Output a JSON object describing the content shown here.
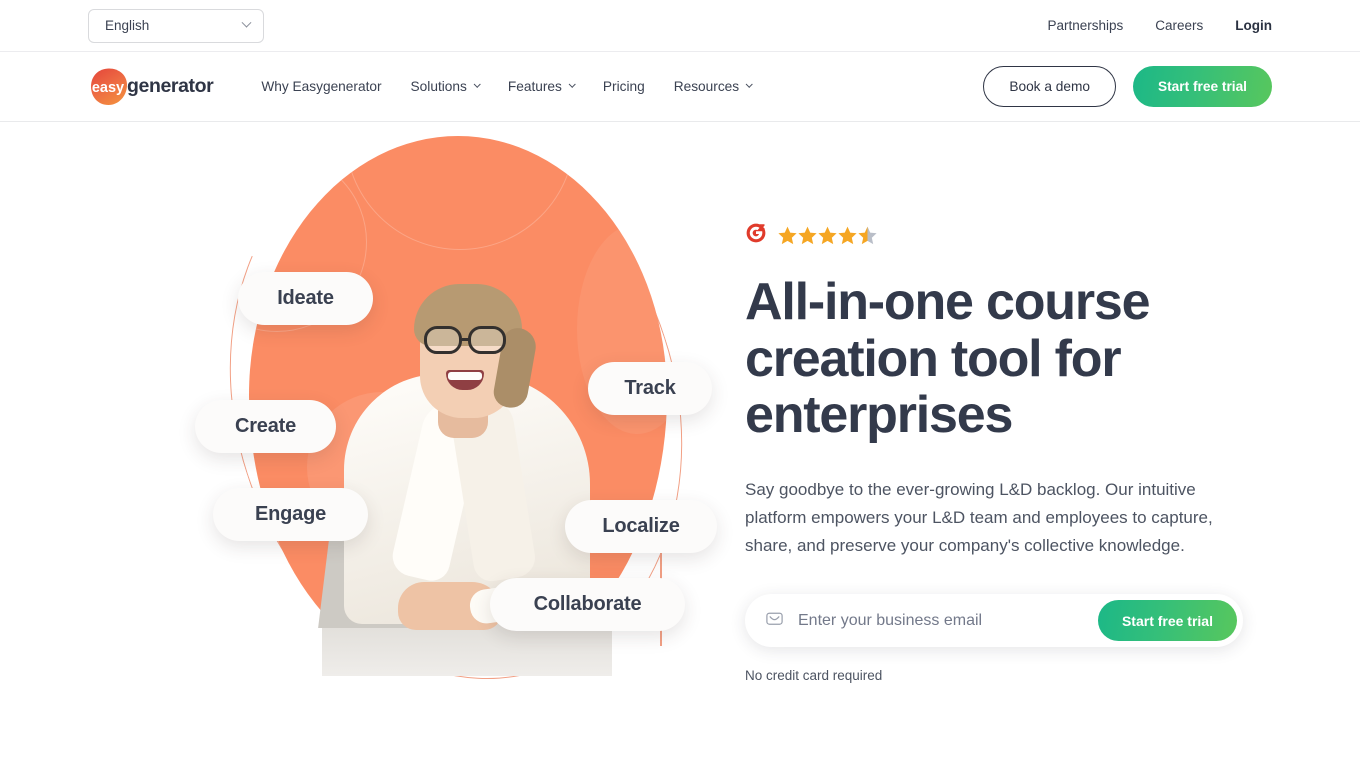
{
  "utility_bar": {
    "language": {
      "value": "English",
      "icon": "chevron-down-icon"
    },
    "links": [
      {
        "label": "Partnerships",
        "bold": false
      },
      {
        "label": "Careers",
        "bold": false
      },
      {
        "label": "Login",
        "bold": true
      }
    ]
  },
  "header": {
    "logo": {
      "mark_text": "easy",
      "word_text": "generator"
    },
    "nav": [
      {
        "label": "Why Easygenerator",
        "has_chevron": false
      },
      {
        "label": "Solutions",
        "has_chevron": true
      },
      {
        "label": "Features",
        "has_chevron": true
      },
      {
        "label": "Pricing",
        "has_chevron": false
      },
      {
        "label": "Resources",
        "has_chevron": true
      }
    ],
    "demo_button": "Book a demo",
    "trial_button": "Start free trial"
  },
  "hero": {
    "rating": {
      "logo": "g2-logo",
      "stars": 4.5,
      "star_count": 5
    },
    "headline": "All-in-one course creation tool for enterprises",
    "subcopy": "Say goodbye to the ever-growing L&D backlog. Our intuitive platform empowers your L&D team and employees to capture, share, and preserve your company's collective knowledge.",
    "form": {
      "icon": "envelope-icon",
      "placeholder": "Enter your business email",
      "value": "",
      "submit_label": "Start free trial"
    },
    "note": "No credit card required",
    "visual": {
      "labels": [
        {
          "text": "Ideate"
        },
        {
          "text": "Create"
        },
        {
          "text": "Engage"
        },
        {
          "text": "Track"
        },
        {
          "text": "Localize"
        },
        {
          "text": "Collaborate"
        }
      ]
    }
  },
  "colors": {
    "coral": "#fb8c64",
    "coral_ring": "#f2a085",
    "green_start": "#1cb887",
    "green_end": "#58c75d",
    "navy": "#333a4b",
    "star": "#f5a623",
    "star_empty": "#b9bec8",
    "g2_red": "#e03b2b"
  }
}
